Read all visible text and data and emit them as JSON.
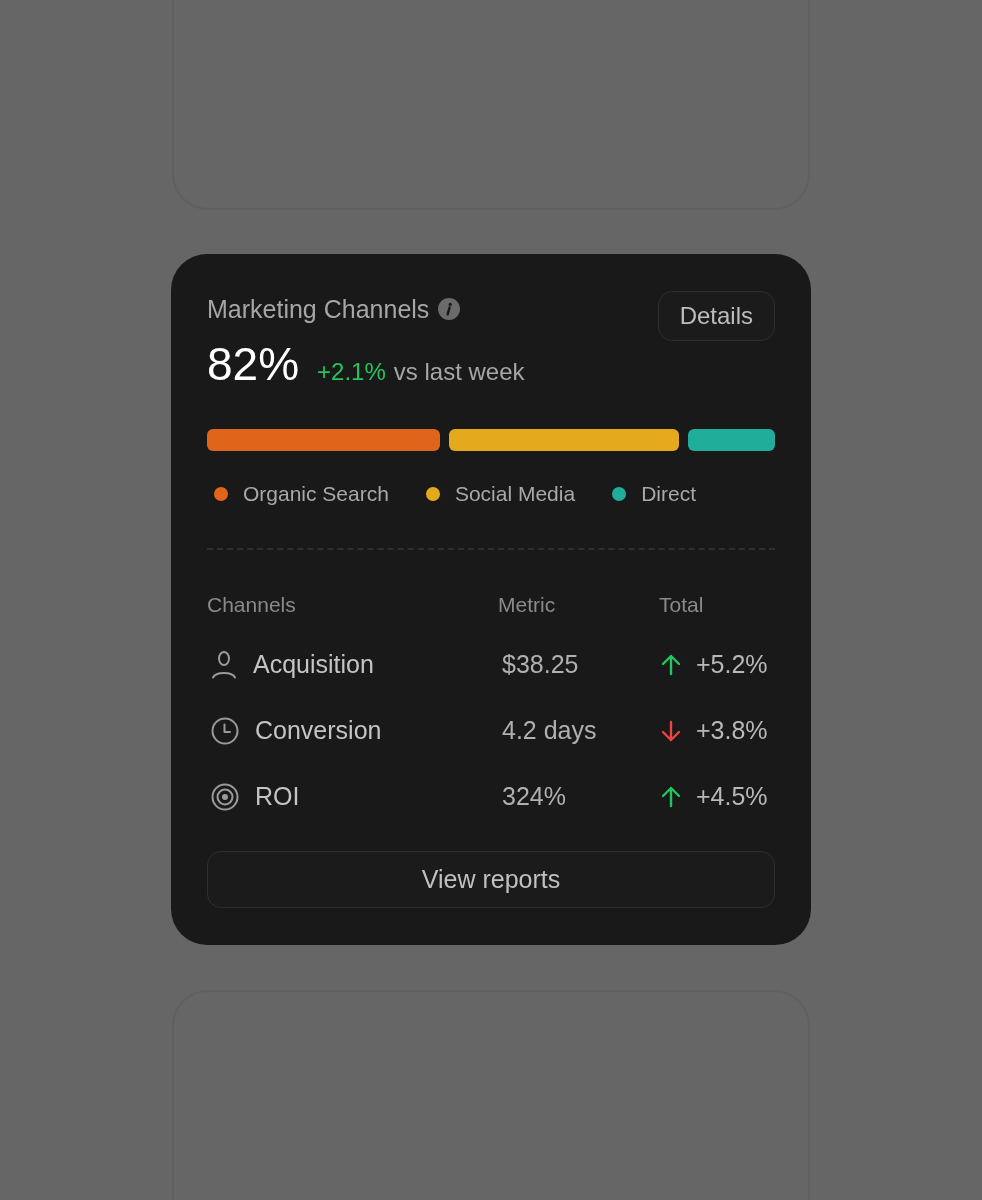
{
  "card": {
    "title": "Marketing Channels",
    "action": "Details",
    "value": "82%",
    "change": "+2.1%",
    "change_label": "vs last week"
  },
  "channels": [
    {
      "name": "Organic Search",
      "color": "#e0651a"
    },
    {
      "name": "Social Media",
      "color": "#e5a91d"
    },
    {
      "name": "Direct",
      "color": "#20ae9a"
    }
  ],
  "table": {
    "columns": [
      "Channels",
      "Metric",
      "Total"
    ],
    "rows": [
      {
        "channel": "Acquisition",
        "metric": "$38.25",
        "up": true,
        "total": "+5.2%"
      },
      {
        "channel": "Conversion",
        "metric": "4.2 days",
        "up": false,
        "total": "+3.8%"
      },
      {
        "channel": "ROI",
        "metric": "324%",
        "up": true,
        "total": "+4.5%"
      }
    ]
  },
  "footer_button": "View reports"
}
